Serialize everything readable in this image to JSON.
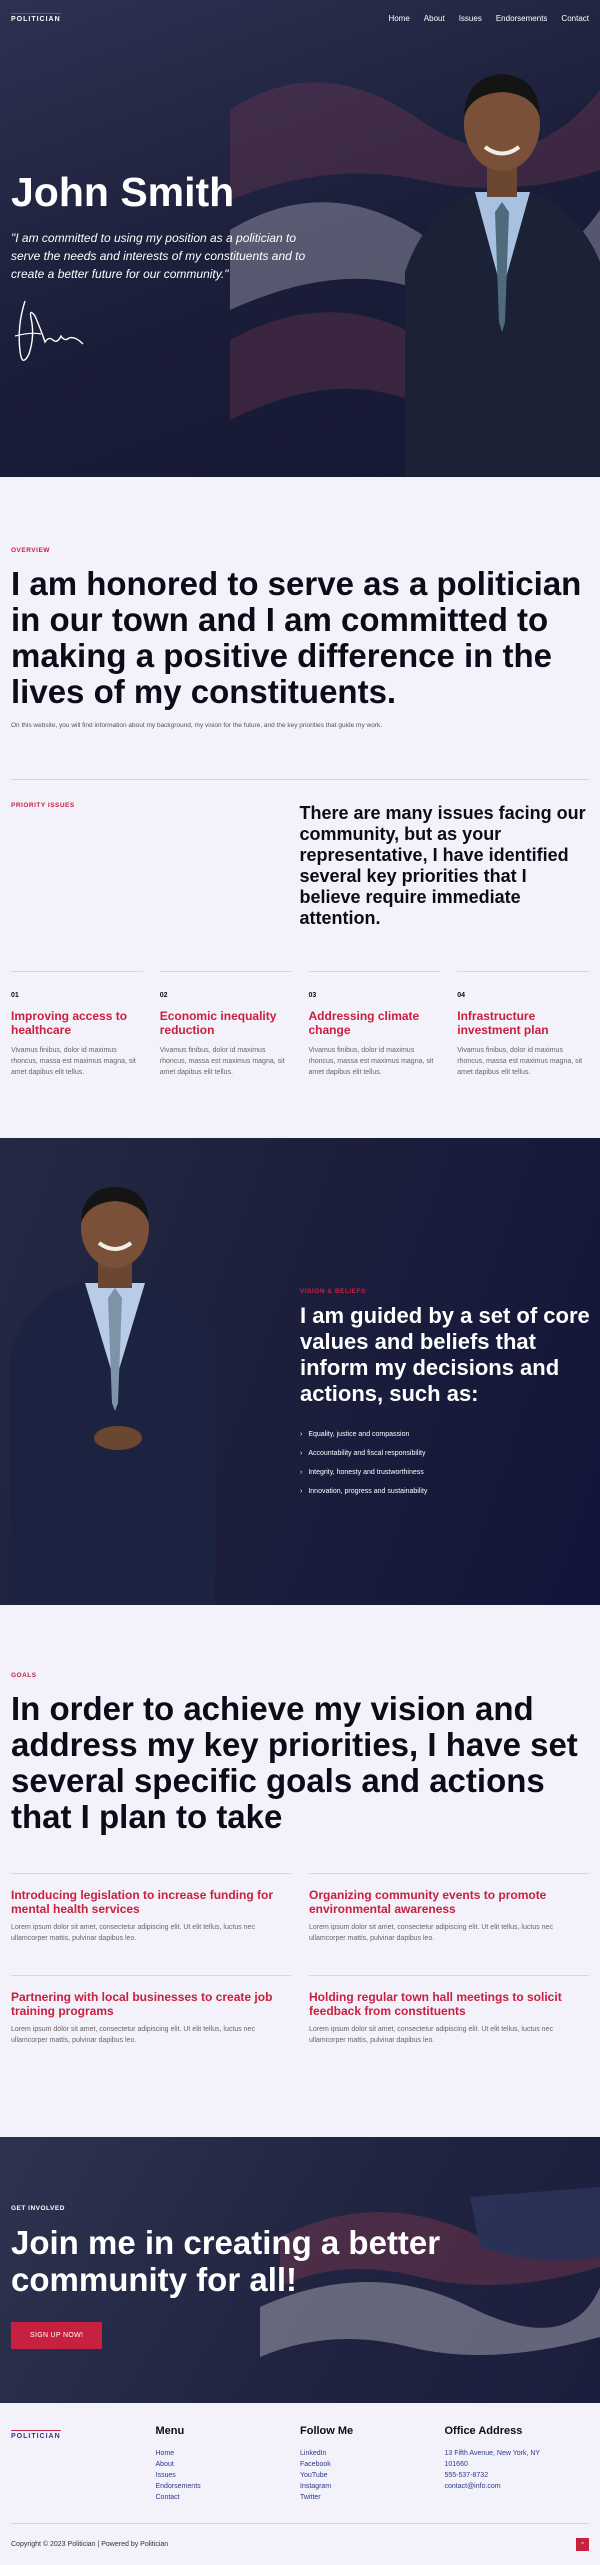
{
  "brand": "POLITICIAN",
  "nav": {
    "links": [
      "Home",
      "About",
      "Issues",
      "Endorsements",
      "Contact"
    ]
  },
  "hero": {
    "name": "John Smith",
    "quote": "\"I am committed to using my position as a politician to serve the needs and interests of my constituents and to create a better future for our community.\""
  },
  "overview": {
    "eyebrow": "OVERVIEW",
    "heading": "I am honored to serve as a politician in our town and I am committed to making a positive difference in the lives of my constituents.",
    "text": "On this website, you will find information about my background, my vision for the future, and the key priorities that guide my work."
  },
  "priority": {
    "eyebrow": "PRIORITY ISSUES",
    "heading": "There are many issues facing our community, but as your representative, I have identified several key priorities that I believe require immediate attention.",
    "items": [
      {
        "num": "01",
        "title": "Improving access to healthcare",
        "desc": "Vivamus finibus, dolor id maximus rhoncus, massa est maximus magna, sit amet dapibus elit tellus."
      },
      {
        "num": "02",
        "title": "Economic inequality reduction",
        "desc": "Vivamus finibus, dolor id maximus rhoncus, massa est maximus magna, sit amet dapibus elit tellus."
      },
      {
        "num": "03",
        "title": "Addressing climate change",
        "desc": "Vivamus finibus, dolor id maximus rhoncus, massa est maximus magna, sit amet dapibus elit tellus."
      },
      {
        "num": "04",
        "title": "Infrastructure investment plan",
        "desc": "Vivamus finibus, dolor id maximus rhoncus, massa est maximus magna, sit amet dapibus elit tellus."
      }
    ]
  },
  "values": {
    "eyebrow": "VISION & BELIEFS",
    "heading": "I am guided by a set of core values and beliefs that inform my decisions and actions, such as:",
    "list": [
      "Equality, justice and compassion",
      "Accountability and fiscal responsibility",
      "Integrity, honesty and trustworthiness",
      "Innovation, progress and sustainability"
    ]
  },
  "goals": {
    "eyebrow": "GOALS",
    "heading": "In order to achieve my vision and address my key priorities, I have set several specific goals and actions that I plan to take",
    "items": [
      {
        "title": "Introducing legislation to increase funding for mental health services",
        "desc": "Lorem ipsum dolor sit amet, consectetur adipiscing elit. Ut elit tellus, luctus nec ullamcorper mattis, pulvinar dapibus leo."
      },
      {
        "title": "Organizing community events to promote environmental awareness",
        "desc": "Lorem ipsum dolor sit amet, consectetur adipiscing elit. Ut elit tellus, luctus nec ullamcorper mattis, pulvinar dapibus leo."
      },
      {
        "title": "Partnering with local businesses to create job training programs",
        "desc": "Lorem ipsum dolor sit amet, consectetur adipiscing elit. Ut elit tellus, luctus nec ullamcorper mattis, pulvinar dapibus leo."
      },
      {
        "title": "Holding regular town hall meetings to solicit feedback from constituents",
        "desc": "Lorem ipsum dolor sit amet, consectetur adipiscing elit. Ut elit tellus, luctus nec ullamcorper mattis, pulvinar dapibus leo."
      }
    ]
  },
  "cta": {
    "eyebrow": "GET INVOLVED",
    "heading": "Join me in creating a better community for all!",
    "button": "SIGN UP NOW!"
  },
  "footer": {
    "menu_title": "Menu",
    "menu": [
      "Home",
      "About",
      "Issues",
      "Endorsements",
      "Contact"
    ],
    "follow_title": "Follow Me",
    "follow": [
      "LinkedIn",
      "Facebook",
      "YouTube",
      "Instagram",
      "Twitter"
    ],
    "office_title": "Office Address",
    "office": [
      "13 Fifth Avenue, New York, NY",
      "101660",
      "555-537-8732",
      "contact@info.com"
    ],
    "copyright": "Copyright © 2023 Politician | Powered by Politician"
  },
  "colors": {
    "accent": "#c8203f",
    "navy": "#1a1d38",
    "background": "#f3f1f9",
    "link": "#2c3a8c"
  }
}
